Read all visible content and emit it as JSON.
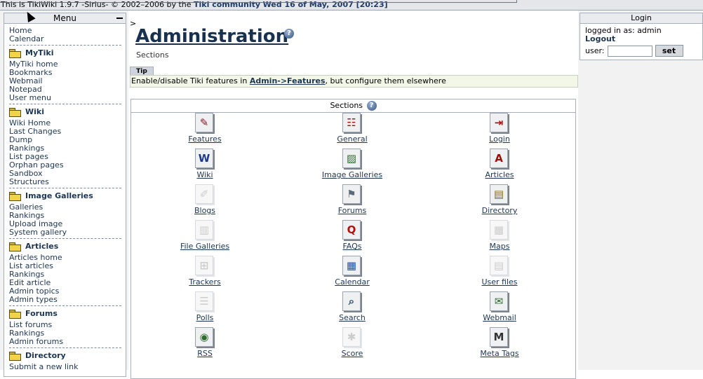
{
  "topbar": {
    "text": "This is TikiWiki 1.9.7 -Sirius- © 2002–2006 by the ",
    "link": "Tiki community",
    "date": "Wed 16 of May, 2007 [20:23]"
  },
  "menu": {
    "title": "Menu",
    "top_links": [
      "Home",
      "Calendar"
    ],
    "sections": [
      {
        "title": "MyTiki",
        "items": [
          "MyTiki home",
          "Bookmarks",
          "Webmail",
          "Notepad",
          "User menu"
        ]
      },
      {
        "title": "Wiki",
        "items": [
          "Wiki Home",
          "Last Changes",
          "Dump",
          "Rankings",
          "List pages",
          "Orphan pages",
          "Sandbox",
          "Structures"
        ]
      },
      {
        "title": "Image Galleries",
        "items": [
          "Galleries",
          "Rankings",
          "Upload image",
          "System gallery"
        ]
      },
      {
        "title": "Articles",
        "items": [
          "Articles home",
          "List articles",
          "Rankings",
          "Edit article",
          "Admin topics",
          "Admin types"
        ]
      },
      {
        "title": "Forums",
        "items": [
          "List forums",
          "Rankings",
          "Admin forums"
        ]
      },
      {
        "title": "Directory",
        "items": [
          "Submit a new link"
        ]
      }
    ]
  },
  "main": {
    "breadcrumb": ">",
    "title": "Administration",
    "help": "?",
    "subtitle": "Sections",
    "tip_label": "Tip",
    "tip_prefix": "Enable/disable Tiki features in ",
    "tip_link": "Admin->Features",
    "tip_suffix": ", but configure them elsewhere",
    "sections_title": "Sections",
    "items": [
      {
        "label": "Features",
        "icon": "features-icon",
        "glyph": "✎",
        "color": "#7a2020",
        "enabled": true
      },
      {
        "label": "General",
        "icon": "general-icon",
        "glyph": "☷",
        "color": "#a01818",
        "enabled": true
      },
      {
        "label": "Login",
        "icon": "login-icon",
        "glyph": "⇥",
        "color": "#b01010",
        "enabled": true
      },
      {
        "label": "Wiki",
        "icon": "wiki-icon",
        "glyph": "W",
        "color": "#1d3a8a",
        "enabled": true
      },
      {
        "label": "Image Galleries",
        "icon": "image-galleries-icon",
        "glyph": "▨",
        "color": "#2f6b2f",
        "enabled": true
      },
      {
        "label": "Articles",
        "icon": "articles-icon",
        "glyph": "A",
        "color": "#9a1010",
        "enabled": true
      },
      {
        "label": "Blogs",
        "icon": "blogs-icon",
        "glyph": "✐",
        "color": "#cccccc",
        "enabled": false
      },
      {
        "label": "Forums",
        "icon": "forums-icon",
        "glyph": "⚑",
        "color": "#5a6b7a",
        "enabled": true
      },
      {
        "label": "Directory",
        "icon": "directory-icon",
        "glyph": "▤",
        "color": "#8a6a10",
        "enabled": true
      },
      {
        "label": "File Galleries",
        "icon": "file-galleries-icon",
        "glyph": "▥",
        "color": "#cccccc",
        "enabled": false
      },
      {
        "label": "FAQs",
        "icon": "faqs-icon",
        "glyph": "Q",
        "color": "#b01010",
        "enabled": true
      },
      {
        "label": "Maps",
        "icon": "maps-icon",
        "glyph": "▦",
        "color": "#cccccc",
        "enabled": false
      },
      {
        "label": "Trackers",
        "icon": "trackers-icon",
        "glyph": "⊞",
        "color": "#cccccc",
        "enabled": false
      },
      {
        "label": "Calendar",
        "icon": "calendar-icon",
        "glyph": "▦",
        "color": "#1f4fb0",
        "enabled": true
      },
      {
        "label": "User files",
        "icon": "user-files-icon",
        "glyph": "▤",
        "color": "#cccccc",
        "enabled": false
      },
      {
        "label": "Polls",
        "icon": "polls-icon",
        "glyph": "☰",
        "color": "#cccccc",
        "enabled": false
      },
      {
        "label": "Search",
        "icon": "search-icon",
        "glyph": "⌕",
        "color": "#2a4a6a",
        "enabled": true
      },
      {
        "label": "Webmail",
        "icon": "webmail-icon",
        "glyph": "✉",
        "color": "#2f6b2f",
        "enabled": true
      },
      {
        "label": "RSS",
        "icon": "rss-icon",
        "glyph": "◉",
        "color": "#2f6b2f",
        "enabled": true
      },
      {
        "label": "Score",
        "icon": "score-icon",
        "glyph": "✱",
        "color": "#cccccc",
        "enabled": false
      },
      {
        "label": "Meta Tags",
        "icon": "meta-tags-icon",
        "glyph": "M",
        "color": "#333333",
        "enabled": true
      }
    ]
  },
  "login": {
    "title": "Login",
    "logged_in_as": "logged in as: admin",
    "logout": "Logout",
    "user_label": "user:",
    "user_value": "",
    "set_button": "set"
  }
}
